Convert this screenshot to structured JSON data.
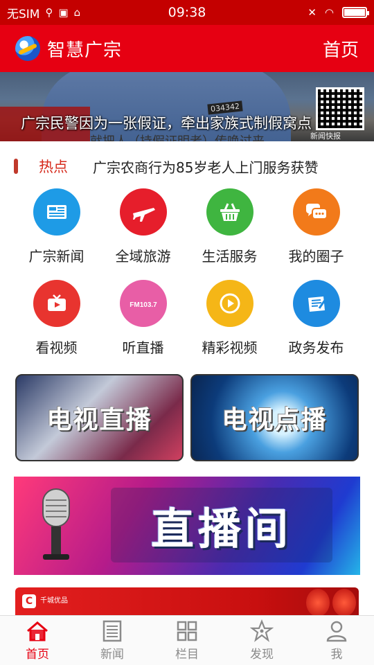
{
  "status_bar": {
    "carrier": "无SIM",
    "time": "09:38"
  },
  "header": {
    "app_title": "智慧广宗",
    "home_link": "首页"
  },
  "banner": {
    "caption": "广宗民警因为一张假证，牵出家族式制假窝点",
    "subtitle_strip": "就把人（持假证明者）传唤过来",
    "badge_number": "034342",
    "watermark": "新闻快报"
  },
  "ticker": {
    "label": "热点",
    "headline": "广宗农商行为85岁老人上门服务获赞"
  },
  "grid": {
    "rows": [
      [
        {
          "label": "广宗新闻",
          "icon": "newspaper-icon",
          "color": "#1e9be6"
        },
        {
          "label": "全域旅游",
          "icon": "airplane-icon",
          "color": "#e61e2b"
        },
        {
          "label": "生活服务",
          "icon": "basket-icon",
          "color": "#3fb540"
        },
        {
          "label": "我的圈子",
          "icon": "chat-bubbles-icon",
          "color": "#f27a1a"
        }
      ],
      [
        {
          "label": "看视频",
          "icon": "tv-icon",
          "color": "#e8342f"
        },
        {
          "label": "听直播",
          "icon": "fm-radio-icon",
          "color": "#e85ea6",
          "icon_text": "FM103.7"
        },
        {
          "label": "精彩视频",
          "icon": "play-icon",
          "color": "#f5b617"
        },
        {
          "label": "政务发布",
          "icon": "document-pen-icon",
          "color": "#1e8be0"
        }
      ]
    ]
  },
  "tv": {
    "live": "电视直播",
    "vod": "电视点播"
  },
  "live_room": {
    "title": "直播间"
  },
  "ad": {
    "logo_text": "C",
    "brand": "千城优品"
  },
  "bottom_nav": {
    "items": [
      {
        "label": "首页",
        "icon": "home-icon",
        "active": true
      },
      {
        "label": "新闻",
        "icon": "news-list-icon",
        "active": false
      },
      {
        "label": "栏目",
        "icon": "grid-icon",
        "active": false
      },
      {
        "label": "发现",
        "icon": "discover-star-icon",
        "active": false
      },
      {
        "label": "我",
        "icon": "person-icon",
        "active": false
      }
    ]
  },
  "colors": {
    "brand_red": "#e60012",
    "status_red": "#c40000",
    "ticker_red": "#d62b1d",
    "nav_inactive": "#8a8a8a"
  }
}
